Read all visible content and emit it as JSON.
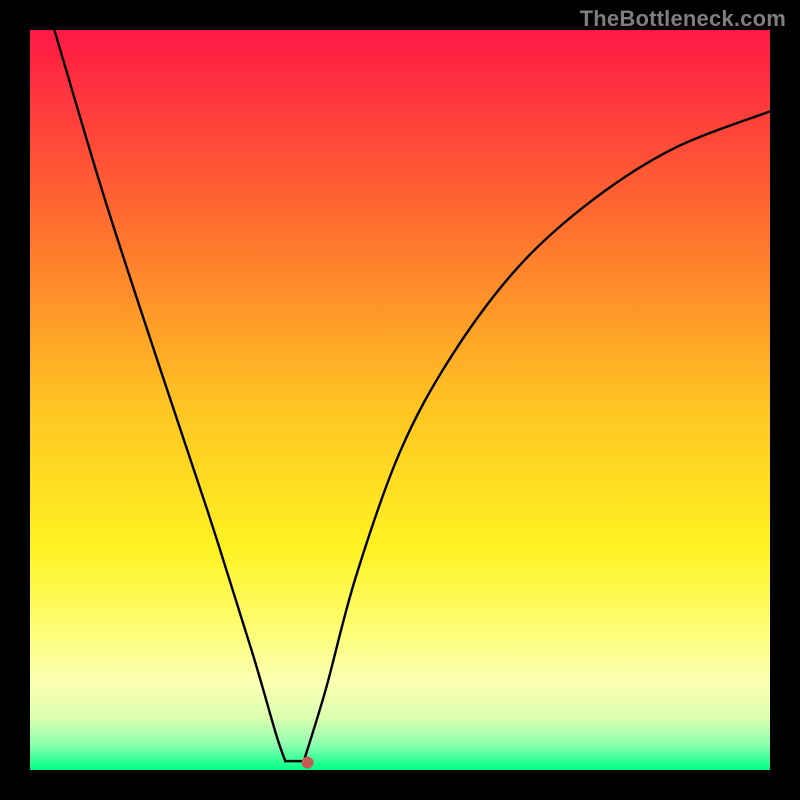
{
  "watermark": "TheBottleneck.com",
  "chart_data": {
    "type": "line",
    "title": "",
    "xlabel": "",
    "ylabel": "",
    "xlim": [
      0,
      1
    ],
    "ylim": [
      0,
      1
    ],
    "gradient_stops": [
      {
        "offset": 0.0,
        "color": "#ff1846"
      },
      {
        "offset": 0.25,
        "color": "#ff6a2f"
      },
      {
        "offset": 0.5,
        "color": "#ffc223"
      },
      {
        "offset": 0.7,
        "color": "#fff221"
      },
      {
        "offset": 0.82,
        "color": "#fdff7c"
      },
      {
        "offset": 0.88,
        "color": "#fcffb2"
      },
      {
        "offset": 0.93,
        "color": "#dcffb0"
      },
      {
        "offset": 0.965,
        "color": "#8fffb0"
      },
      {
        "offset": 1.0,
        "color": "#00ff88"
      }
    ],
    "curves": [
      {
        "name": "left-branch",
        "points": [
          {
            "x": 0.033,
            "y": 1.0
          },
          {
            "x": 0.1,
            "y": 0.775
          },
          {
            "x": 0.17,
            "y": 0.56
          },
          {
            "x": 0.24,
            "y": 0.35
          },
          {
            "x": 0.3,
            "y": 0.16
          },
          {
            "x": 0.332,
            "y": 0.05
          },
          {
            "x": 0.345,
            "y": 0.012
          }
        ]
      },
      {
        "name": "valley-floor",
        "points": [
          {
            "x": 0.345,
            "y": 0.012
          },
          {
            "x": 0.37,
            "y": 0.012
          }
        ]
      },
      {
        "name": "right-branch",
        "points": [
          {
            "x": 0.37,
            "y": 0.012
          },
          {
            "x": 0.4,
            "y": 0.11
          },
          {
            "x": 0.44,
            "y": 0.26
          },
          {
            "x": 0.5,
            "y": 0.43
          },
          {
            "x": 0.57,
            "y": 0.56
          },
          {
            "x": 0.66,
            "y": 0.68
          },
          {
            "x": 0.76,
            "y": 0.77
          },
          {
            "x": 0.87,
            "y": 0.84
          },
          {
            "x": 1.0,
            "y": 0.89
          }
        ]
      }
    ],
    "marker": {
      "x": 0.375,
      "y": 0.01,
      "color": "#c35b52"
    }
  }
}
